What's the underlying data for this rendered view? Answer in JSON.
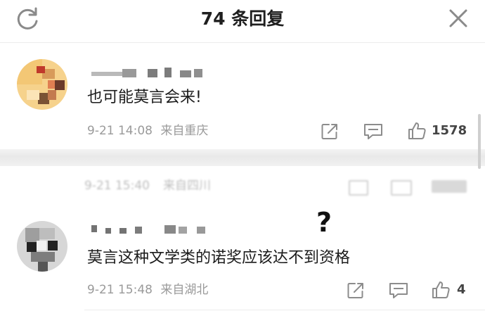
{
  "header": {
    "title": "74 条回复",
    "refresh_icon": "refresh-icon",
    "close_icon": "close-icon"
  },
  "comments": [
    {
      "text": "也可能莫言会来!",
      "date": "9-21 14:08",
      "location": "来自重庆",
      "like_count": "1578"
    },
    {
      "date": "9-21 15:40",
      "location": "来自四川"
    },
    {
      "text": "莫言这种文学类的诺奖应该达不到资格",
      "date": "9-21 15:48",
      "location": "来自湖北",
      "like_count": "4"
    }
  ],
  "annotation": "?",
  "colors": {
    "text": "#1b1b1b",
    "meta": "#9a9a9a",
    "icon": "#8c8c8c"
  }
}
